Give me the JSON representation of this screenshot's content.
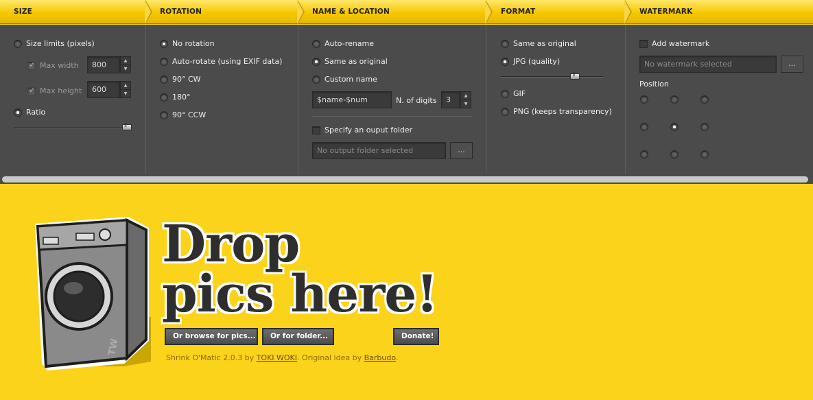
{
  "header": {
    "tabs": [
      "SIZE",
      "ROTATION",
      "NAME & LOCATION",
      "FORMAT",
      "WATERMARK"
    ]
  },
  "size": {
    "size_limits_label": "Size limits (pixels)",
    "max_width_label": "Max width",
    "max_width_value": "800",
    "max_height_label": "Max height",
    "max_height_value": "600",
    "ratio_label": "Ratio",
    "ratio_slider_fraction": 1.0,
    "selected": "Ratio"
  },
  "rotation": {
    "options": [
      "No rotation",
      "Auto-rotate (using EXIF data)",
      "90° CW",
      "180°",
      "90° CCW"
    ],
    "selected": "No rotation"
  },
  "name_location": {
    "options": [
      "Auto-rename",
      "Same as original",
      "Custom name"
    ],
    "selected": "Same as original",
    "custom_name_value": "$name-$num",
    "digits_label": "N. of digits",
    "digits_value": "3",
    "output_folder_label": "Specify an ouput folder",
    "output_folder_placeholder": "No output folder selected",
    "browse_label": "..."
  },
  "format": {
    "same_as_original_label": "Same as original",
    "jpg_label": "JPG (quality)",
    "jpg_quality_fraction": 0.75,
    "gif_label": "GIF",
    "png_label": "PNG (keeps transparency)",
    "selected": "JPG (quality)"
  },
  "watermark": {
    "add_label": "Add watermark",
    "field_placeholder": "No watermark selected",
    "browse_label": "...",
    "position_label": "Position",
    "selected_position": "center"
  },
  "drop": {
    "line1": "Drop",
    "line2": "pics here!",
    "browse_pics_label": "Or browse for pics...",
    "browse_folder_label": "Or for folder...",
    "donate_label": "Donate!",
    "credits_prefix": "Shrink O'Matic 2.0.3 by ",
    "credits_author": "TOKI WOKI",
    "credits_middle": ". Original idea by ",
    "credits_idea": "Barbudo",
    "credits_suffix": ".",
    "machine_badge": "TW"
  },
  "colors": {
    "accent_yellow": "#fcd31b",
    "panel_gray": "#4b4b4b",
    "text_dark": "#2e2e2e"
  }
}
